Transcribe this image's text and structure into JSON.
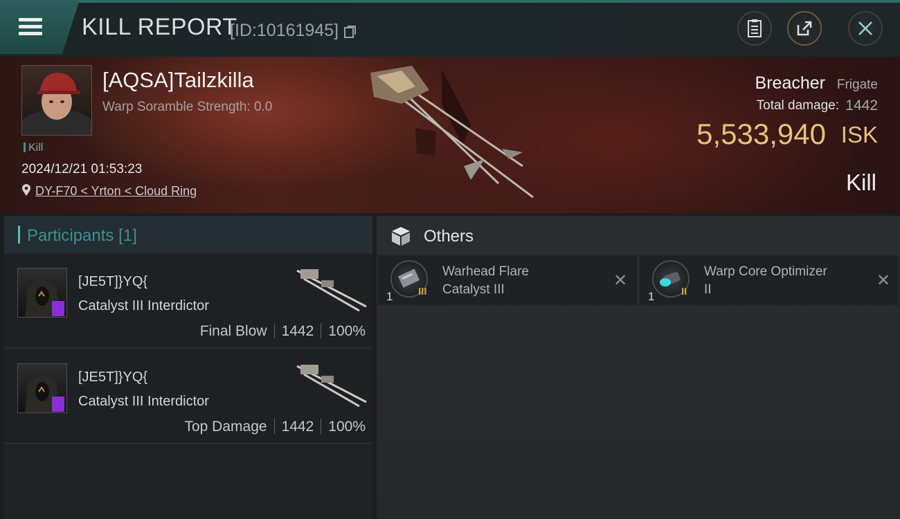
{
  "header": {
    "title": "KILL REPORT",
    "report_id": "[ID:10161945]",
    "icons": [
      "menu-icon",
      "copy-icon",
      "clipboard-icon",
      "share-icon",
      "close-icon"
    ]
  },
  "victim": {
    "name": "[AQSA]Tailzkilla",
    "scramble": "Warp Soramble Strength: 0.0",
    "tag": "Kill",
    "datetime": "2024/12/21 01:53:23",
    "location": "DY-F70 < Yrton < Cloud Ring",
    "ship_name": "Breacher",
    "ship_class": "Frigate",
    "damage_label": "Total damage:",
    "damage_value": "1442",
    "isk_value": "5,533,940",
    "isk_unit": "ISK",
    "result": "Kill"
  },
  "participants": {
    "title": "Participants",
    "count": "[1]",
    "rows": [
      {
        "name": "[JE5T]}YQ{",
        "ship": "Catalyst III Interdictor",
        "role": "Final Blow",
        "damage": "1442",
        "percent": "100%"
      },
      {
        "name": "[JE5T]}YQ{",
        "ship": "Catalyst III Interdictor",
        "role": "Top Damage",
        "damage": "1442",
        "percent": "100%"
      }
    ]
  },
  "others": {
    "title": "Others",
    "items": [
      {
        "name_line1": "Warhead Flare",
        "name_line2": "Catalyst III",
        "qty": "1",
        "tier": "III",
        "close": "✕"
      },
      {
        "name_line1": "Warp Core Optimizer",
        "name_line2": "II",
        "qty": "1",
        "tier": "II",
        "close": "✕"
      }
    ]
  },
  "colors": {
    "accent": "#4ec1bd",
    "isk": "#e6c27a",
    "badge": "#8a2fd6"
  }
}
